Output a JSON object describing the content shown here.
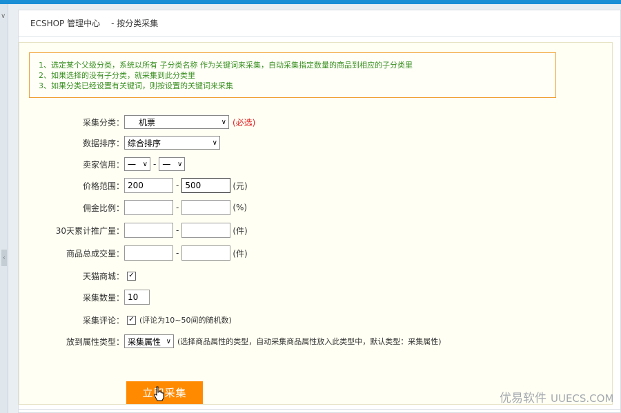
{
  "header": {
    "title": "ECSHOP 管理中心",
    "subtitle": "- 按分类采集"
  },
  "notice": [
    "1、选定某个父级分类，系统以所有 子分类名称 作为关键词来采集，自动采集指定数量的商品到相应的子分类里",
    "2、如果选择的没有子分类，就采集到此分类里",
    "3、如果分类已经设置有关键词，则按设置的关键词来采集"
  ],
  "form": {
    "category": {
      "label": "采集分类：",
      "value": "机票",
      "required": "(必选)"
    },
    "sort": {
      "label": "数据排序：",
      "value": "综合排序"
    },
    "credit": {
      "label": "卖家信用：",
      "from": "一",
      "to": "一"
    },
    "price": {
      "label": "价格范围：",
      "from": "200",
      "to": "500",
      "unit": "(元)"
    },
    "commission": {
      "label": "佣金比例：",
      "from": "",
      "to": "",
      "unit": "(%)"
    },
    "promo30": {
      "label": "30天累计推广量：",
      "from": "",
      "to": "",
      "unit": "(件)"
    },
    "total_sales": {
      "label": "商品总成交量：",
      "from": "",
      "to": "",
      "unit": "(件)"
    },
    "tmall": {
      "label": "天猫商城：",
      "checked": true
    },
    "count": {
      "label": "采集数量：",
      "value": "10"
    },
    "reviews": {
      "label": "采集评论：",
      "checked": true,
      "hint": "(评论为10~50间的随机数)"
    },
    "attr_type": {
      "label": "放到属性类型：",
      "value": "采集属性",
      "hint": "(选择商品属性的类型，自动采集商品属性放入此类型中，默认类型：采集属性)"
    },
    "submit_label": "立即采集"
  },
  "watermark": {
    "cn": "优易软件",
    "en": "UUECS.COM"
  },
  "colors": {
    "accent": "#1b8fd6",
    "button": "#ff8a00",
    "notice_text": "#3a8f22",
    "notice_border": "#f0a030",
    "required": "#e02020"
  }
}
